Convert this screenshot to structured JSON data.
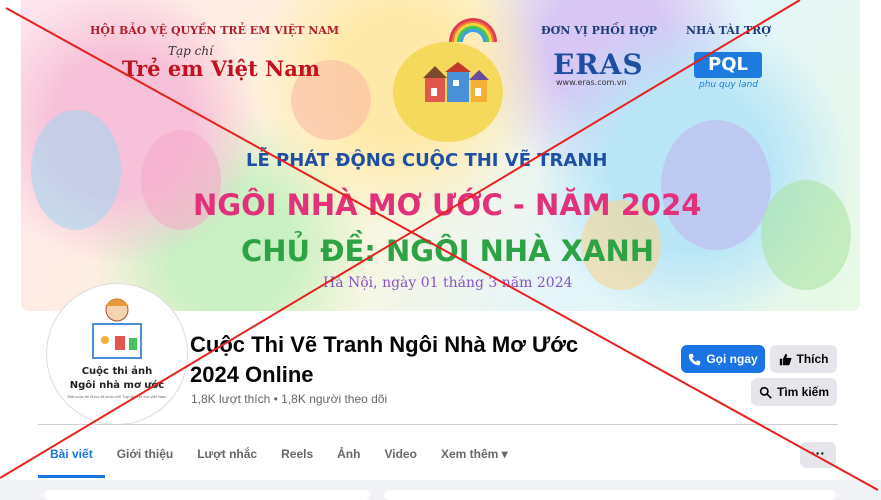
{
  "cover": {
    "org_name": "HỘI BẢO VỆ QUYỀN TRẺ EM VIỆT NAM",
    "magazine_small": "Tạp chí",
    "magazine_name": "Trẻ em Việt Nam",
    "coordinator_label": "ĐƠN VỊ PHỐI HỢP",
    "coordinator_logo": "ERAS",
    "coordinator_url": "www.eras.com.vn",
    "sponsor_label": "NHÀ TÀI TRỢ",
    "sponsor_logo": "PQL",
    "sponsor_sub": "phu quy land",
    "headline1": "LỄ PHÁT ĐỘNG CUỘC THI VẼ TRANH",
    "headline2": "NGÔI NHÀ MƠ ƯỚC - NĂM 2024",
    "headline3": "CHỦ ĐỀ: NGÔI NHÀ XANH",
    "date_line": "Hà Nội, ngày 01 tháng 3 năm 2024"
  },
  "avatar": {
    "line1": "Cuộc thi ảnh",
    "line2": "Ngôi nhà mơ ước",
    "line3": "Một cuộc thi được tổ chức bởi Tạp chí Trẻ em Việt Nam"
  },
  "page": {
    "name": "Cuộc Thi Vẽ Tranh Ngôi Nhà Mơ Ước 2024 Online",
    "likes": "1,8K lượt thích",
    "separator": "•",
    "followers": "1,8K người theo dõi"
  },
  "actions": {
    "call": "Gọi ngay",
    "like": "Thích",
    "search": "Tìm kiếm",
    "more": "···"
  },
  "tabs": [
    {
      "label": "Bài viết"
    },
    {
      "label": "Giới thiệu"
    },
    {
      "label": "Lượt nhắc"
    },
    {
      "label": "Reels"
    },
    {
      "label": "Ảnh"
    },
    {
      "label": "Video"
    },
    {
      "label": "Xem thêm ▾"
    }
  ],
  "colors": {
    "accent": "#1b74e4",
    "cross": "#e8201d"
  }
}
